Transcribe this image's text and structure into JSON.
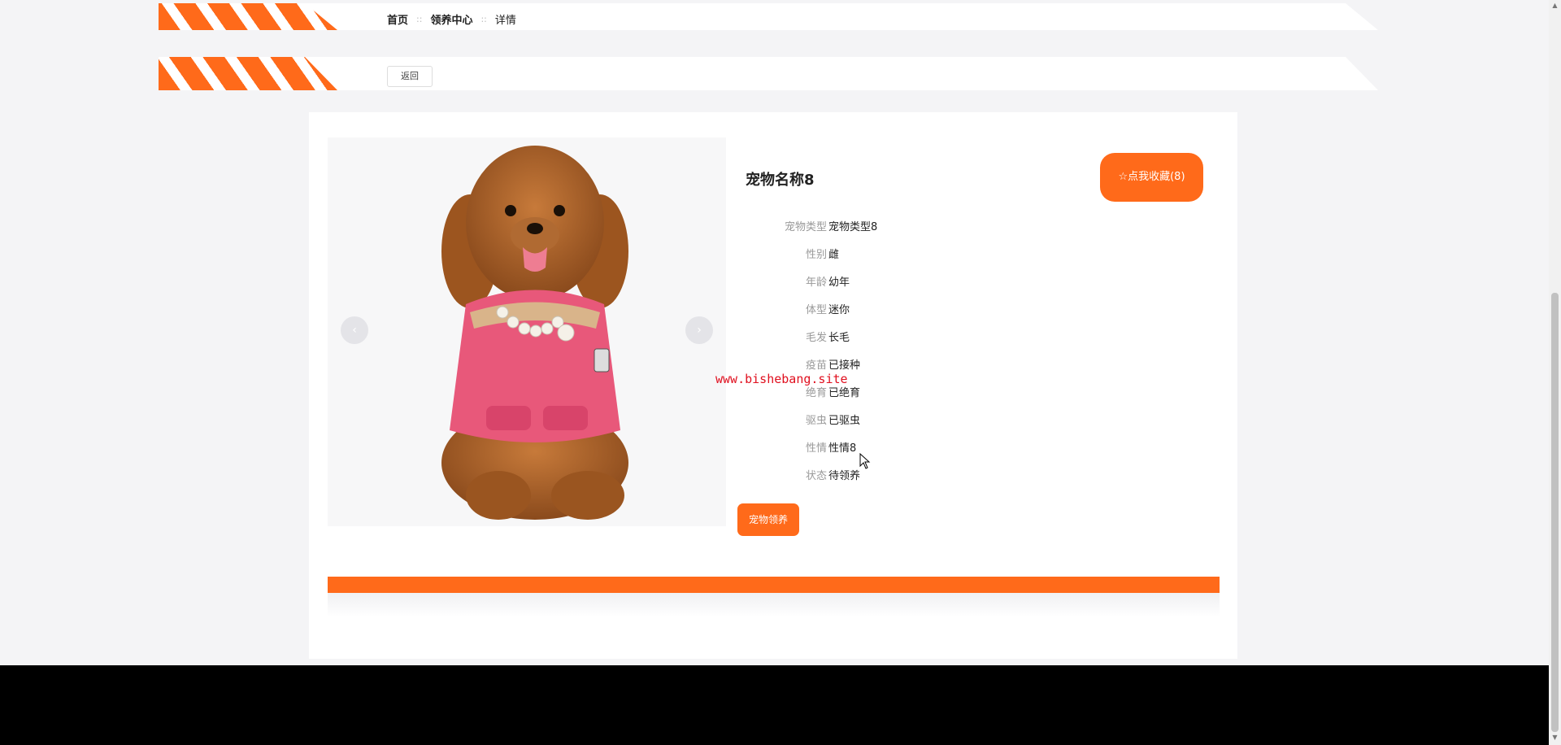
{
  "breadcrumb": {
    "home": "首页",
    "center": "领养中心",
    "current": "详情",
    "separator": "::"
  },
  "back_label": "返回",
  "pet": {
    "name": "宠物名称8",
    "favorite_label": "☆点我收藏(8)",
    "attributes": [
      {
        "key": "宠物类型",
        "value": "宠物类型8"
      },
      {
        "key": "性别",
        "value": "雌"
      },
      {
        "key": "年龄",
        "value": "幼年"
      },
      {
        "key": "体型",
        "value": "迷你"
      },
      {
        "key": "毛发",
        "value": "长毛"
      },
      {
        "key": "疫苗",
        "value": "已接种"
      },
      {
        "key": "绝育",
        "value": "已绝育"
      },
      {
        "key": "驱虫",
        "value": "已驱虫"
      },
      {
        "key": "性情",
        "value": "性情8"
      },
      {
        "key": "状态",
        "value": "待领养"
      }
    ],
    "adopt_label": "宠物领养"
  },
  "watermark": "www.bishebang.site",
  "colors": {
    "accent": "#ff6a1a",
    "page_bg": "#f4f4f6"
  }
}
